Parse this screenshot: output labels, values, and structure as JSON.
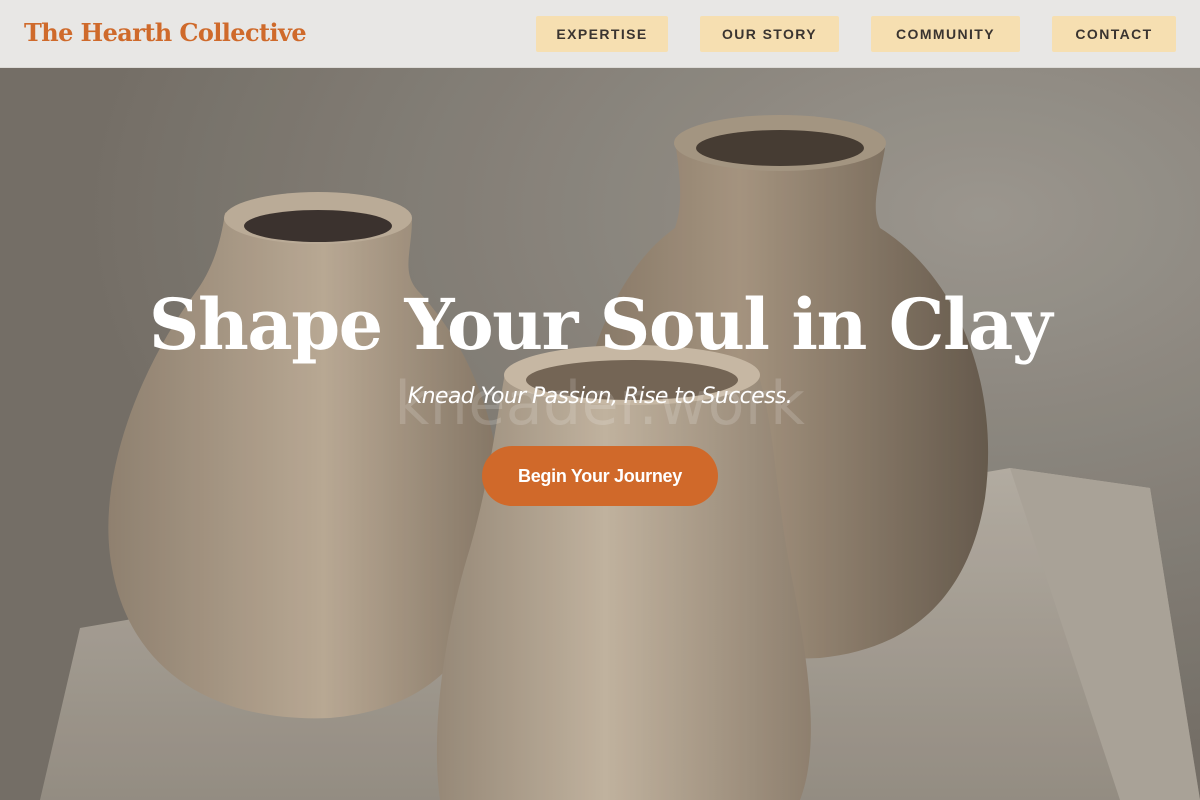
{
  "header": {
    "brand": "The Hearth Collective",
    "nav": [
      {
        "label": "EXPERTISE"
      },
      {
        "label": "OUR STORY"
      },
      {
        "label": "COMMUNITY"
      },
      {
        "label": "CONTACT"
      }
    ]
  },
  "hero": {
    "title": "Shape Your Soul in Clay",
    "subtitle": "Knead Your Passion, Rise to Success.",
    "watermark": "kneader.work",
    "cta_label": "Begin Your Journey"
  },
  "colors": {
    "brand": "#cf6a2b",
    "nav_button_bg": "#f6dfb1",
    "cta_bg": "#d0692a",
    "header_bg": "#e8e7e5"
  }
}
